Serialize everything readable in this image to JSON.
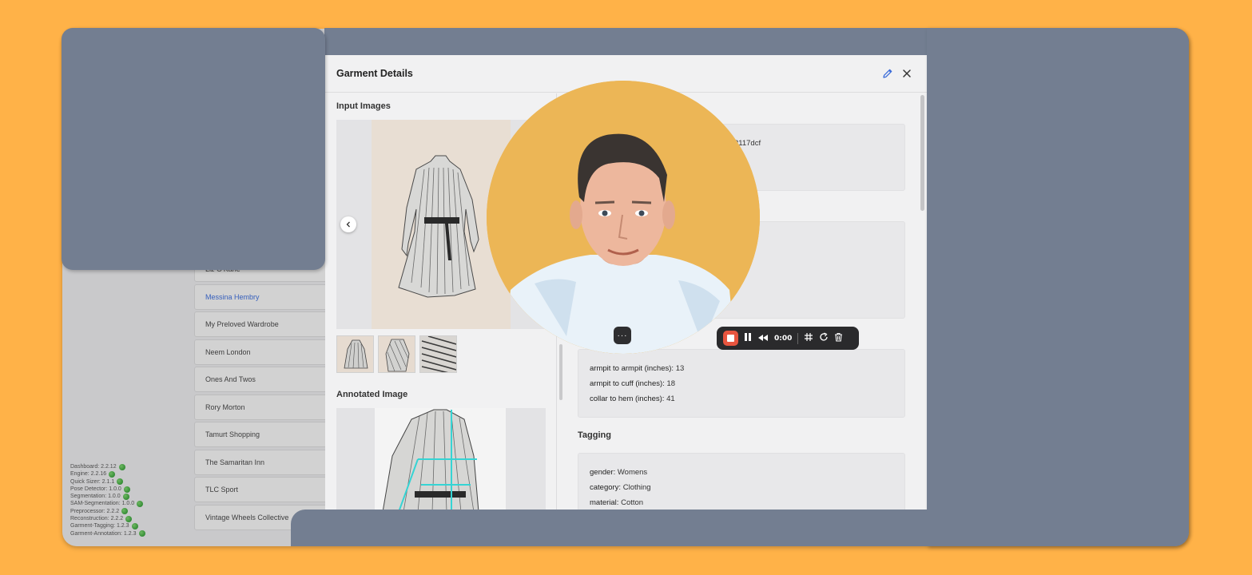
{
  "background_app": {
    "retailers": [
      {
        "label": "Liz O'Kane",
        "active": false
      },
      {
        "label": "Messina Hembry",
        "active": true
      },
      {
        "label": "My Preloved Wardrobe",
        "active": false
      },
      {
        "label": "Neem London",
        "active": false
      },
      {
        "label": "Ones And Twos",
        "active": false
      },
      {
        "label": "Rory Morton",
        "active": false
      },
      {
        "label": "Tamurt Shopping",
        "active": false
      },
      {
        "label": "The Samaritan Inn",
        "active": false
      },
      {
        "label": "TLC Sport",
        "active": false
      },
      {
        "label": "Vintage Wheels Collective",
        "active": false
      }
    ],
    "versions": [
      "Dashboard: 2.2.12",
      "Engine: 2.2.16",
      "Quick Sizer: 2.1.1",
      "Pose Detector: 1.0.0",
      "Segmentation: 1.0.0",
      "SAM-Segmentation: 1.0.0",
      "Preprocessor: 2.2.2",
      "Reconstruction: 2.2.2",
      "Garment-Tagging: 1.2.3",
      "Garment-Annotation: 1.2.3"
    ],
    "status_color": "#1C8B25"
  },
  "modal": {
    "title": "Garment Details",
    "edit_icon": "pencil-icon",
    "close_icon": "close-icon",
    "input_images_title": "Input Images",
    "annotated_image_title": "Annotated Image",
    "id_fragment": "2117dcf",
    "measurements": [
      {
        "key": "armpit to armpit (inches):",
        "value": "13"
      },
      {
        "key": "armpit to cuff (inches):",
        "value": "18"
      },
      {
        "key": "collar to hem (inches):",
        "value": "41"
      }
    ],
    "tagging_title": "Tagging",
    "tags": [
      {
        "key": "gender:",
        "value": "Womens"
      },
      {
        "key": "category:",
        "value": "Clothing"
      },
      {
        "key": "material:",
        "value": "Cotton"
      }
    ]
  },
  "recorder": {
    "time": "0:00",
    "more_label": "···",
    "accent_color": "#E8553F"
  },
  "colors": {
    "background": "#FFB248",
    "desktop_window": "#737E91",
    "link_blue": "#3B6CD9"
  }
}
